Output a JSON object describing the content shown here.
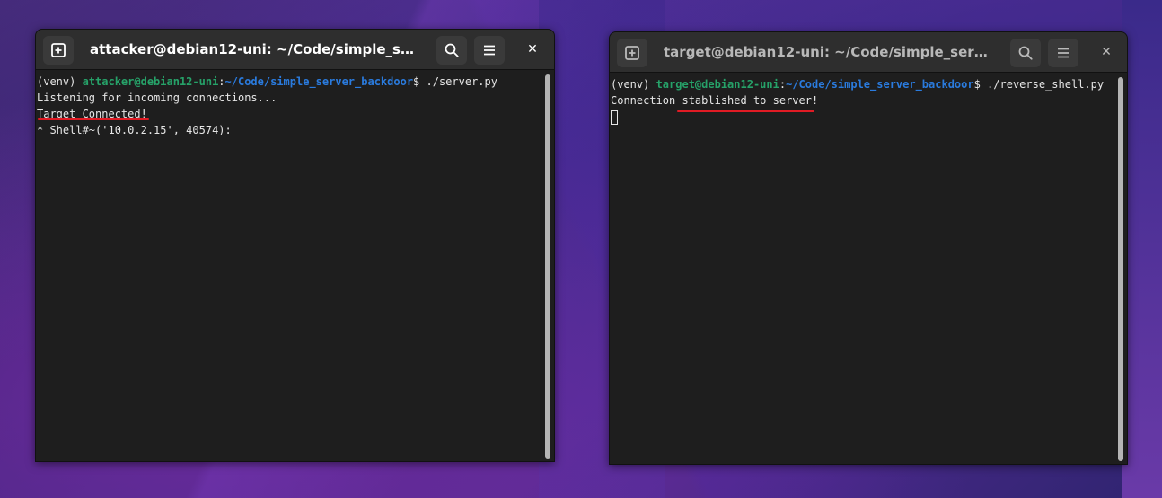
{
  "left_terminal": {
    "title": "attacker@debian12-uni: ~/Code/simple_server_bac…",
    "prompt_venv": "(venv) ",
    "prompt_user": "attacker@debian12-uni",
    "prompt_sep": ":",
    "prompt_path": "~/Code/simple_server_backdoor",
    "prompt_cmd": "$ ./server.py",
    "lines": [
      "Listening for incoming connections...",
      "Target Connected!",
      "* Shell#~('10.0.2.15', 40574):"
    ]
  },
  "right_terminal": {
    "title": "target@debian12-uni: ~/Code/simple_server_backd…",
    "prompt_venv": "(venv) ",
    "prompt_user": "target@debian12-uni",
    "prompt_sep": ":",
    "prompt_path": "~/Code/simple_server_backdoor",
    "prompt_cmd": "$ ./reverse_shell.py",
    "lines": [
      "Connection stablished to server!"
    ]
  },
  "icons": {
    "new_tab": "new-tab-icon",
    "search": "search-icon",
    "menu": "hamburger-menu-icon",
    "close": "close-icon"
  },
  "close_glyph": "✕",
  "colors": {
    "user_host": "#26a269",
    "path": "#2a7bde",
    "underline": "#e01b24",
    "terminal_bg": "#1e1e1e",
    "titlebar_bg": "#2e2e2e"
  }
}
